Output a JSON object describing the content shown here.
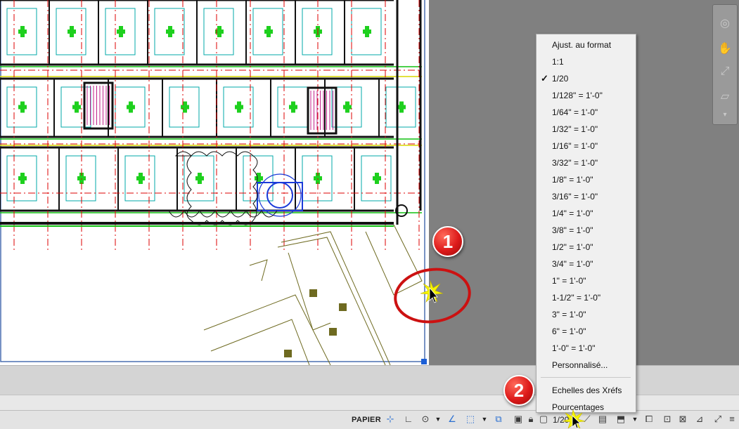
{
  "status_bar": {
    "papier_label": "PAPIER",
    "scale_value": "1/20"
  },
  "scale_menu": {
    "items": [
      {
        "label": "Ajust. au format",
        "checked": false
      },
      {
        "label": "1:1",
        "checked": false
      },
      {
        "label": "1/20",
        "checked": true
      },
      {
        "label": "1/128\" = 1'-0\"",
        "checked": false
      },
      {
        "label": "1/64\" = 1'-0\"",
        "checked": false
      },
      {
        "label": "1/32\" = 1'-0\"",
        "checked": false
      },
      {
        "label": "1/16\" = 1'-0\"",
        "checked": false
      },
      {
        "label": "3/32\" = 1'-0\"",
        "checked": false
      },
      {
        "label": "1/8\" = 1'-0\"",
        "checked": false
      },
      {
        "label": "3/16\" = 1'-0\"",
        "checked": false
      },
      {
        "label": "1/4\" = 1'-0\"",
        "checked": false
      },
      {
        "label": "3/8\" = 1'-0\"",
        "checked": false
      },
      {
        "label": "1/2\" = 1'-0\"",
        "checked": false
      },
      {
        "label": "3/4\" = 1'-0\"",
        "checked": false
      },
      {
        "label": "1\" = 1'-0\"",
        "checked": false
      },
      {
        "label": "1-1/2\" = 1'-0\"",
        "checked": false
      },
      {
        "label": "3\" = 1'-0\"",
        "checked": false
      },
      {
        "label": "6\" = 1'-0\"",
        "checked": false
      },
      {
        "label": "1'-0\" = 1'-0\"",
        "checked": false
      },
      {
        "label": "Personnalisé...",
        "checked": false
      }
    ],
    "extra_items": [
      {
        "label": "Echelles des Xréfs"
      },
      {
        "label": "Pourcentages"
      }
    ],
    "check_glyph": "✓"
  },
  "callouts": [
    {
      "number": "1"
    },
    {
      "number": "2"
    }
  ],
  "colors": {
    "callout_red": "#dd1a1a",
    "drawing_bg": "#ffffff",
    "workspace_gray": "#808080",
    "status_bg": "#e3e3e3",
    "menu_bg": "#f0f0f0"
  },
  "icons": {
    "status_bar": [
      "snap-icon",
      "grid-icon",
      "ortho-icon",
      "polar-icon",
      "isodraft-icon",
      "object-snap-icon",
      "dynamic-input-icon",
      "lineweight-icon",
      "transparency-icon",
      "selection-cycling-icon",
      "annotation-scale-icon",
      "workspace-icon",
      "lock-ui-icon",
      "isolate-objects-icon",
      "hardware-acceleration-icon",
      "clean-screen-icon",
      "customization-icon"
    ],
    "nav_bar": [
      "steering-wheel-icon",
      "pan-icon",
      "zoom-extents-icon",
      "orbit-icon",
      "showmotion-icon"
    ]
  }
}
